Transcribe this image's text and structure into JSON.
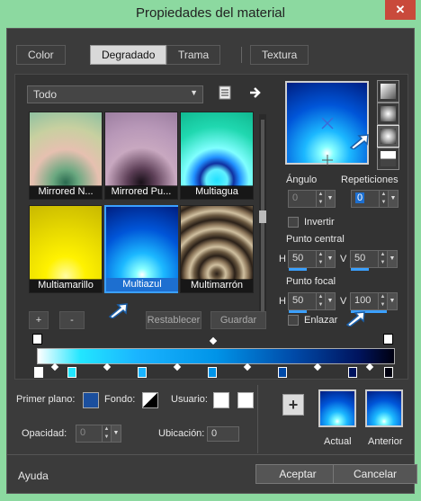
{
  "window": {
    "title": "Propiedades del material",
    "close_label": "✕"
  },
  "tabs": [
    {
      "label": "Color",
      "active": false
    },
    {
      "label": "Degradado",
      "active": true
    },
    {
      "label": "Trama",
      "active": false
    },
    {
      "label": "Textura",
      "active": false
    }
  ],
  "gallery": {
    "filter_value": "Todo",
    "items": [
      {
        "label": "Mirrored N..."
      },
      {
        "label": "Mirrored Pu..."
      },
      {
        "label": "Multiagua"
      },
      {
        "label": "Multiamarillo"
      },
      {
        "label": "Multiazul",
        "selected": true
      },
      {
        "label": "Multimarrón"
      }
    ],
    "add_label": "+",
    "remove_label": "-",
    "reset_label": "Restablecer",
    "save_label": "Guardar"
  },
  "angle": {
    "label": "Ángulo",
    "value": "0"
  },
  "repeats": {
    "label": "Repeticiones",
    "value": "0"
  },
  "invert_label": "Invertir",
  "center_point": {
    "label": "Punto central",
    "h_label": "H",
    "h_value": "50",
    "v_label": "V",
    "v_value": "50"
  },
  "focal_point": {
    "label": "Punto focal",
    "h_label": "H",
    "h_value": "50",
    "v_label": "V",
    "v_value": "100"
  },
  "link_label": "Enlazar",
  "bottom": {
    "foreground_label": "Primer plano:",
    "background_label": "Fondo:",
    "user_label": "Usuario:",
    "opacity_label": "Opacidad:",
    "opacity_value": "0",
    "location_label": "Ubicación:",
    "location_value": "0",
    "current_label": "Actual",
    "previous_label": "Anterior"
  },
  "footer": {
    "help_label": "Ayuda",
    "ok_label": "Aceptar",
    "cancel_label": "Cancelar"
  }
}
